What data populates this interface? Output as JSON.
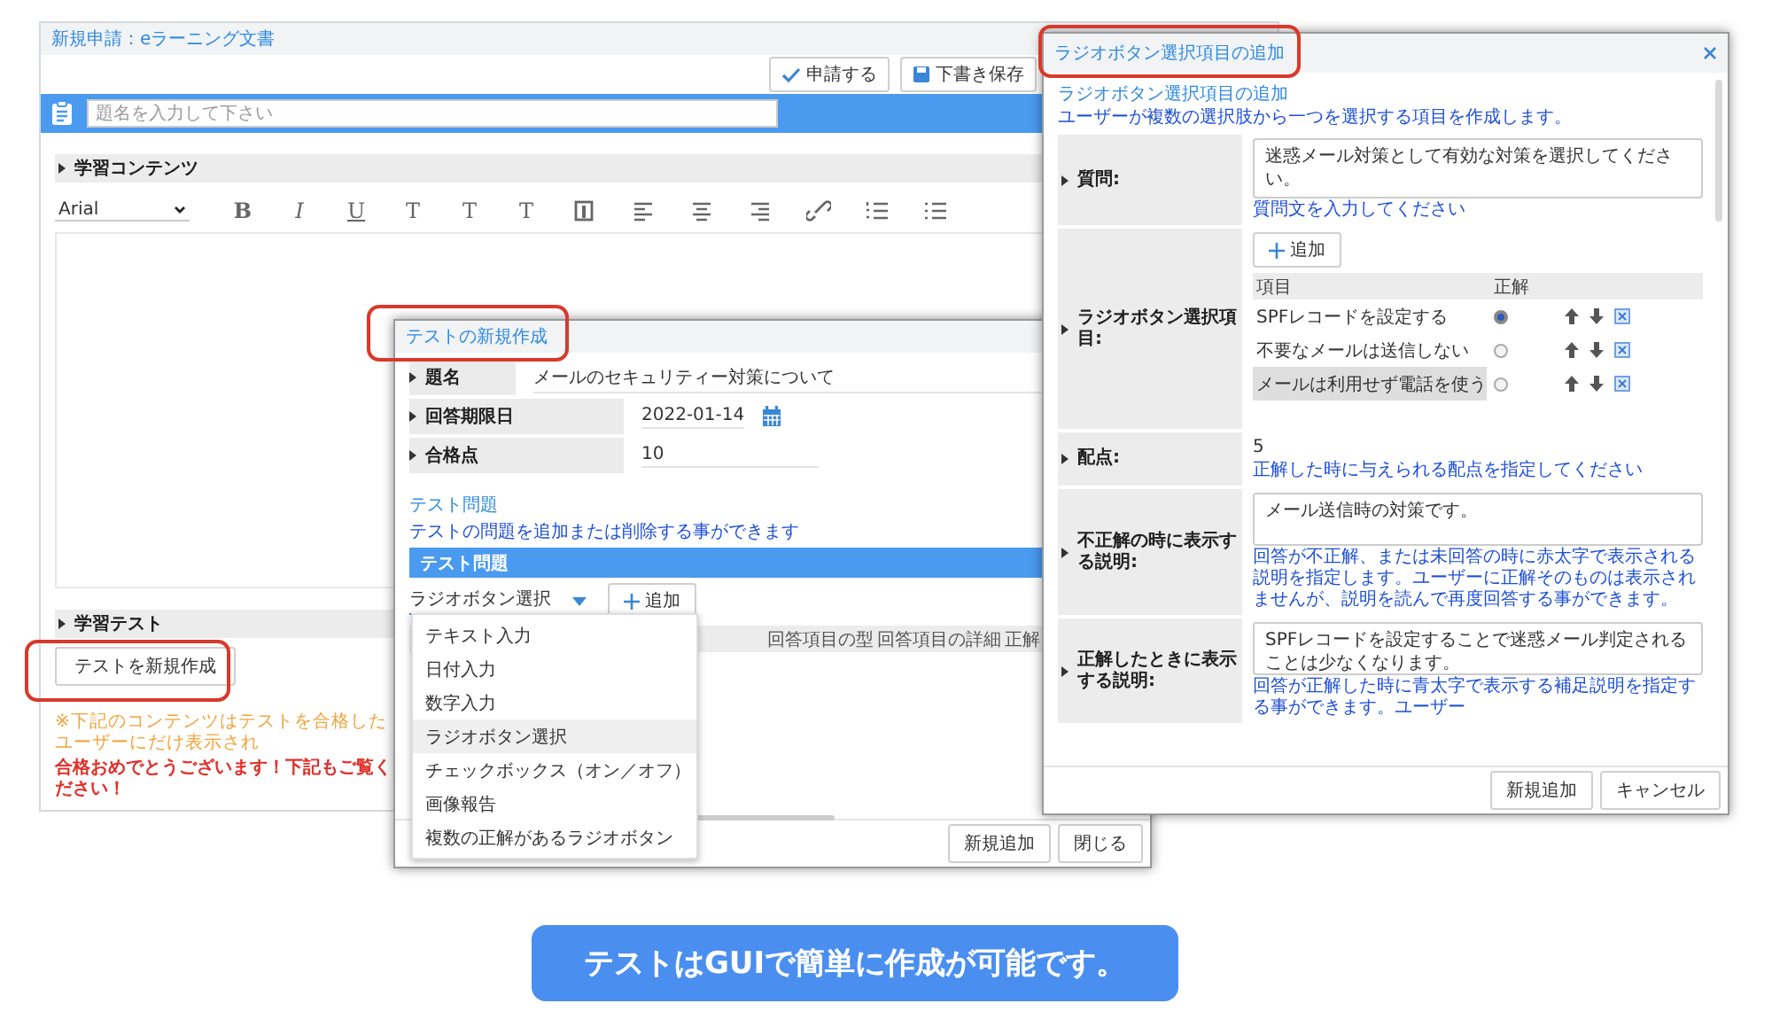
{
  "main_window": {
    "title": "新規申請：eラーニング文書",
    "buttons": [
      {
        "label": "申請する",
        "kind": "check"
      },
      {
        "label": "下書き保存",
        "kind": "save"
      }
    ],
    "title_field": {
      "placeholder": "題名を入力して下さい"
    },
    "content_section": "学習コンテンツ",
    "editor": {
      "font": "Arial",
      "format_buttons": [
        "B",
        "I",
        "U",
        "T",
        "T",
        "T"
      ]
    },
    "test_section": "学習テスト",
    "create_test_button": "テストを新規作成",
    "notice": "※下記のコンテンツはテストを合格したユーザーにだけ表示され",
    "congrats": "合格おめでとうございます！下記もご覧ください！"
  },
  "test_dialog": {
    "title": "テストの新規作成",
    "fields": [
      {
        "label": "題名",
        "value": "メールのセキュリティー対策について",
        "kind": "text"
      },
      {
        "label": "回答期限日",
        "value": "2022-01-14",
        "kind": "date"
      },
      {
        "label": "合格点",
        "value": "10",
        "kind": "number"
      }
    ],
    "questions_link": "テスト問題",
    "questions_desc": "テストの問題を追加または削除する事ができます",
    "questions_header": "テスト問題",
    "type_select": "ラジオボタン選択",
    "add_button": "追加",
    "columns": [
      "回答項目の型",
      "回答項目の詳細",
      "正解"
    ],
    "type_options": [
      {
        "label": "テキスト入力",
        "selected": false
      },
      {
        "label": "日付入力",
        "selected": false
      },
      {
        "label": "数字入力",
        "selected": false
      },
      {
        "label": "ラジオボタン選択",
        "selected": true
      },
      {
        "label": "チェックボックス（オン／オフ）",
        "selected": false
      },
      {
        "label": "画像報告",
        "selected": false
      },
      {
        "label": "複数の正解があるラジオボタン",
        "selected": false
      }
    ],
    "footer_buttons": [
      "新規追加",
      "閉じる"
    ]
  },
  "radio_dialog": {
    "title": "ラジオボタン選択項目の追加",
    "heading": "ラジオボタン選択項目の追加",
    "description": "ユーザーが複数の選択肢から一つを選択する項目を作成します。",
    "question": {
      "label": "質問:",
      "value": "迷惑メール対策として有効な対策を選択してください。",
      "hint": "質問文を入力してください"
    },
    "choices_label": "ラジオボタン選択項目:",
    "add_button": "追加",
    "choice_columns": [
      "項目",
      "正解"
    ],
    "choices": [
      {
        "label": "SPFレコードを設定する",
        "correct": true,
        "highlighted": false
      },
      {
        "label": "不要なメールは送信しない",
        "correct": false,
        "highlighted": false
      },
      {
        "label": "メールは利用せず電話を使う",
        "correct": false,
        "highlighted": true
      }
    ],
    "score": {
      "label": "配点:",
      "value": "5",
      "hint": "正解した時に与えられる配点を指定してください"
    },
    "wrong_explanation": {
      "label": "不正解の時に表示する説明:",
      "value": "メール送信時の対策です。",
      "hint": "回答が不正解、または未回答の時に赤太字で表示される説明を指定します。ユーザーに正解そのものは表示されませんが、説明を読んで再度回答する事ができます。"
    },
    "right_explanation": {
      "label": "正解したときに表示する説明:",
      "value": "SPFレコードを設定することで迷惑メール判定されることは少なくなります。",
      "hint": "回答が正解した時に青太字で表示する補足説明を指定する事ができます。ユーザー"
    },
    "footer_buttons": [
      "新規追加",
      "キャンセル"
    ]
  },
  "caption": "テストはGUIで簡単に作成が可能です。"
}
